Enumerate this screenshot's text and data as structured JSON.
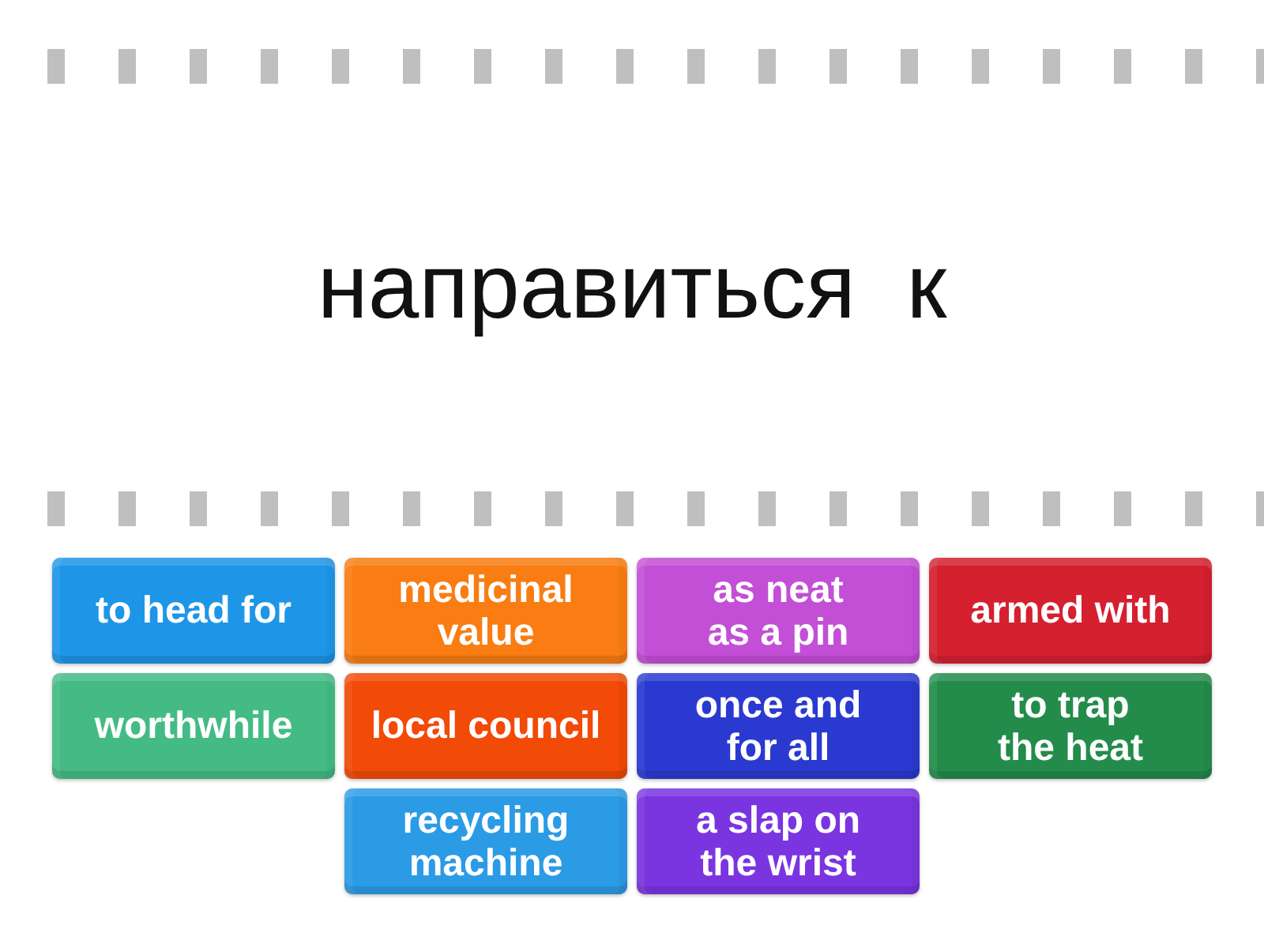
{
  "prompt": {
    "text": "направиться  к"
  },
  "tile_columns": [
    {
      "tiles": [
        {
          "text": "to head for",
          "color": "#1e96e8"
        },
        {
          "text": "worthwhile",
          "color": "#44bb85"
        }
      ]
    },
    {
      "tiles": [
        {
          "text": "medicinal value",
          "color": "#f97d12"
        },
        {
          "text": "local council",
          "color": "#f24a07"
        },
        {
          "text": "recycling machine",
          "color": "#2c9be6"
        }
      ]
    },
    {
      "tiles": [
        {
          "text": "as neat as a pin",
          "color": "#c34fd6"
        },
        {
          "text": "once and for all",
          "color": "#2a3ad1"
        },
        {
          "text": "a slap on the wrist",
          "color": "#7a35e0"
        }
      ]
    },
    {
      "tiles": [
        {
          "text": "armed with",
          "color": "#d4202f"
        },
        {
          "text": "to trap the heat",
          "color": "#238c4b"
        }
      ]
    }
  ]
}
